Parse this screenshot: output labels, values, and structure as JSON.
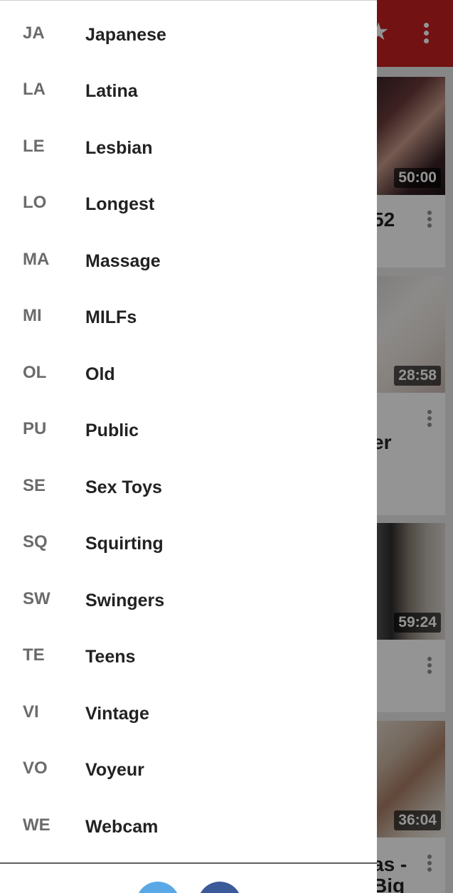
{
  "background": {
    "appbar_color": "#c4201f",
    "appbar_icons": [
      "star-icon",
      "more-vert-icon"
    ],
    "cards": [
      {
        "duration": "50:00",
        "title_fragment": "52"
      },
      {
        "duration": "28:58",
        "title_fragment": "er"
      },
      {
        "duration": "59:24",
        "title_fragment": ""
      },
      {
        "duration": "36:04",
        "title_fragment": "as -",
        "title_fragment2": "Big"
      }
    ]
  },
  "drawer": {
    "items": [
      {
        "abbr": "JA",
        "label": "Japanese"
      },
      {
        "abbr": "LA",
        "label": "Latina"
      },
      {
        "abbr": "LE",
        "label": "Lesbian"
      },
      {
        "abbr": "LO",
        "label": "Longest"
      },
      {
        "abbr": "MA",
        "label": "Massage"
      },
      {
        "abbr": "MI",
        "label": "MILFs"
      },
      {
        "abbr": "OL",
        "label": "Old"
      },
      {
        "abbr": "PU",
        "label": "Public"
      },
      {
        "abbr": "SE",
        "label": "Sex Toys"
      },
      {
        "abbr": "SQ",
        "label": "Squirting"
      },
      {
        "abbr": "SW",
        "label": "Swingers"
      },
      {
        "abbr": "TE",
        "label": "Teens"
      },
      {
        "abbr": "VI",
        "label": "Vintage"
      },
      {
        "abbr": "VO",
        "label": "Voyeur"
      },
      {
        "abbr": "WE",
        "label": "Webcam"
      }
    ],
    "footer_buttons": [
      {
        "icon": "twitter-icon",
        "color": "#5aa9e6"
      },
      {
        "icon": "facebook-icon",
        "color": "#3b5a9a"
      }
    ]
  }
}
